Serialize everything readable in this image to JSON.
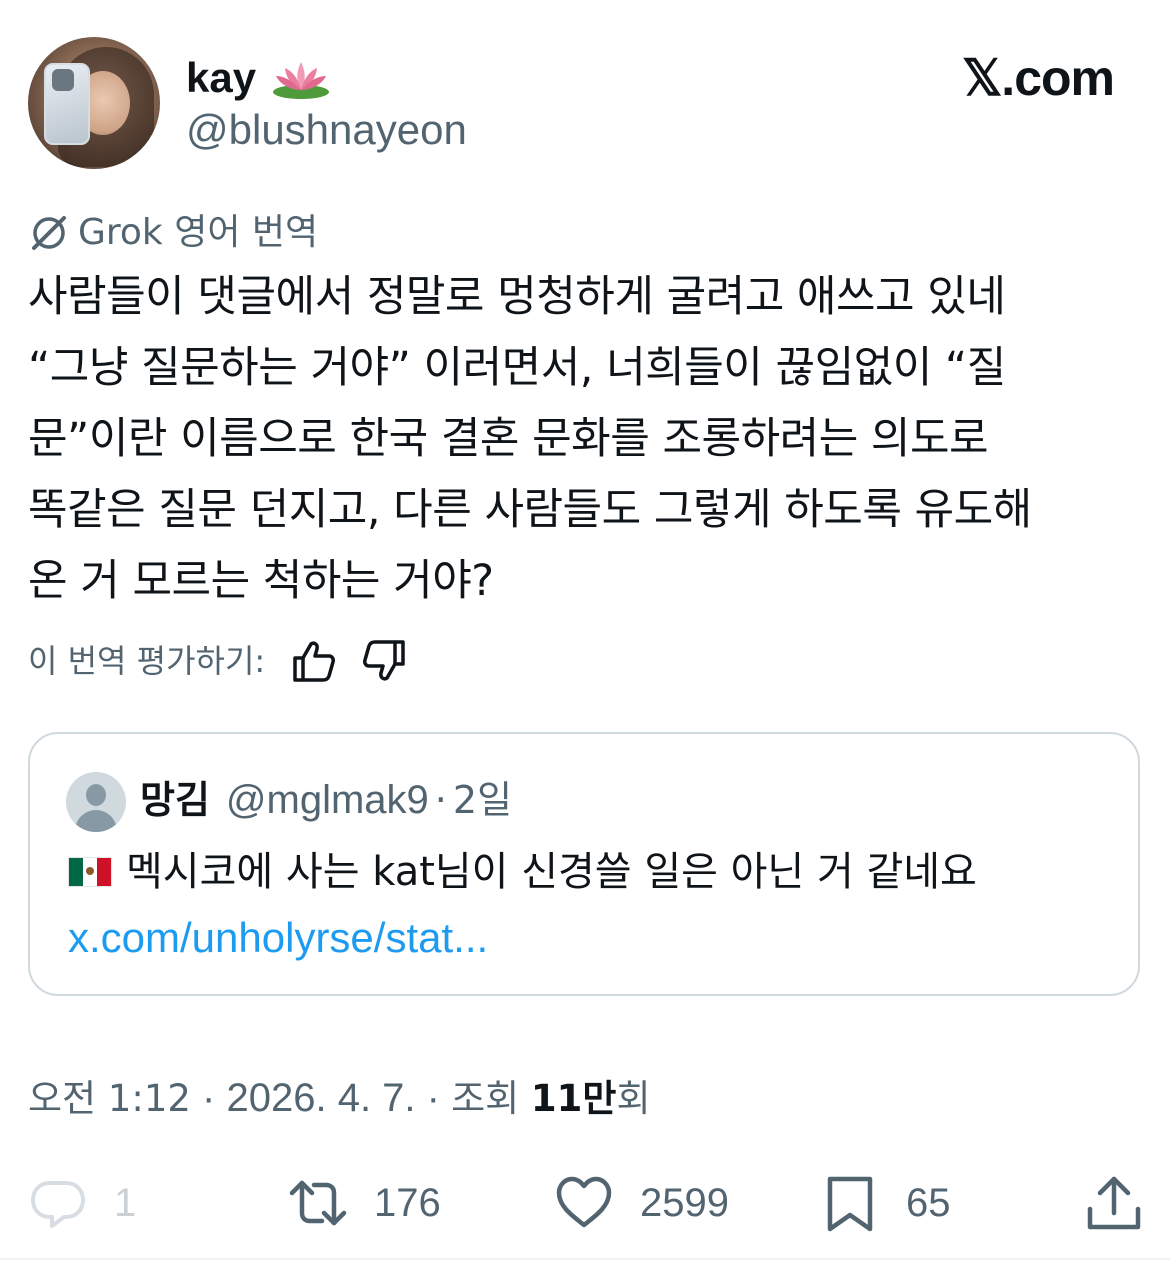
{
  "author": {
    "display_name": "kay",
    "emoji": "lotus",
    "handle": "@blushnayeon"
  },
  "brand": {
    "logo_text": "𝕏.com"
  },
  "translation": {
    "label": "Grok 영어 번역",
    "rate_label": "이 번역 평가하기:"
  },
  "tweet": {
    "text": "사람들이 댓글에서 정말로 멍청하게 굴려고 애쓰고 있네\n“그냥 질문하는 거야” 이러면서, 너희들이 끊임없이 “질\n문”이란 이름으로 한국 결혼 문화를 조롱하려는 의도로\n똑같은 질문 던지고, 다른 사람들도 그렇게 하도록 유도해\n온 거 모르는 척하는 거야?"
  },
  "quote": {
    "name": "망김",
    "handle": "@mglmak9",
    "separator": "·",
    "time": "2일",
    "flag": "mexico-flag",
    "text": "멕시코에 사는 kat님이 신경쓸 일은 아닌 거 같네요",
    "link": "x.com/unholyrse/stat..."
  },
  "meta": {
    "time": "오전 1:12",
    "sep": " · ",
    "date": "2026. 4. 7.",
    "views_label_pre": "조회 ",
    "views_count": "11만",
    "views_label_post": "회"
  },
  "actions": {
    "replies": "1",
    "reposts": "176",
    "likes": "2599",
    "bookmarks": "65"
  },
  "colors": {
    "text": "#0f1419",
    "secondary": "#536471",
    "link": "#1d9bf0",
    "border": "#cfd9de"
  }
}
